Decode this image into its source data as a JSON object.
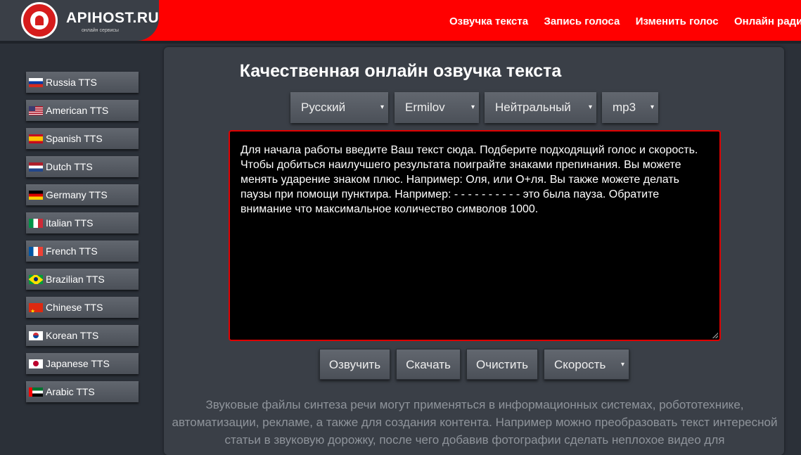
{
  "header": {
    "logo_title": "APIHOST.RU",
    "logo_subtitle": "онлайн сервисы",
    "nav": [
      "Озвучка текста",
      "Запись голоса",
      "Изменить голос",
      "Онлайн радио"
    ]
  },
  "sidebar": {
    "items": [
      {
        "label": "Russia TTS",
        "flag": "ru"
      },
      {
        "label": "American TTS",
        "flag": "us"
      },
      {
        "label": "Spanish TTS",
        "flag": "es"
      },
      {
        "label": "Dutch TTS",
        "flag": "nl"
      },
      {
        "label": "Germany TTS",
        "flag": "de"
      },
      {
        "label": "Italian TTS",
        "flag": "it"
      },
      {
        "label": "French TTS",
        "flag": "fr"
      },
      {
        "label": "Brazilian TTS",
        "flag": "br"
      },
      {
        "label": "Chinese TTS",
        "flag": "cn"
      },
      {
        "label": "Korean TTS",
        "flag": "kr"
      },
      {
        "label": "Japanese TTS",
        "flag": "jp"
      },
      {
        "label": "Arabic TTS",
        "flag": "ae"
      }
    ]
  },
  "main": {
    "title": "Качественная онлайн озвучка текста",
    "selects": {
      "language": "Русский",
      "voice": "Ermilov",
      "emotion": "Нейтральный",
      "format": "mp3"
    },
    "text": "Для начала работы введите Ваш текст сюда. Подберите подходящий голос и скорость. Чтобы добиться наилучшего результата поиграйте знаками препинания. Вы можете менять ударение знаком плюс. Например: Оля, или О+ля.  Вы также можете делать паузы при помощи пунктира. Например: - - - - - - - - - - это была пауза. Обратите внимание что максимальное количество символов 1000.",
    "buttons": {
      "speak": "Озвучить",
      "download": "Скачать",
      "clear": "Очистить",
      "speed": "Скорость"
    },
    "description": "Звуковые файлы синтеза речи могут применяться в информационных системах, робототехнике, автоматизации, рекламе, а также для создания контента. Например можно преобразовать текст интересной статьи в звуковую дорожку, после чего добавив фотографии сделать неплохое видео для"
  },
  "icons": {
    "select_arrow": "▾"
  },
  "colors": {
    "header_bg": "#ff0000",
    "page_bg": "#2b3038",
    "panel_bg": "#3a3f47",
    "editor_border": "#e00000"
  }
}
